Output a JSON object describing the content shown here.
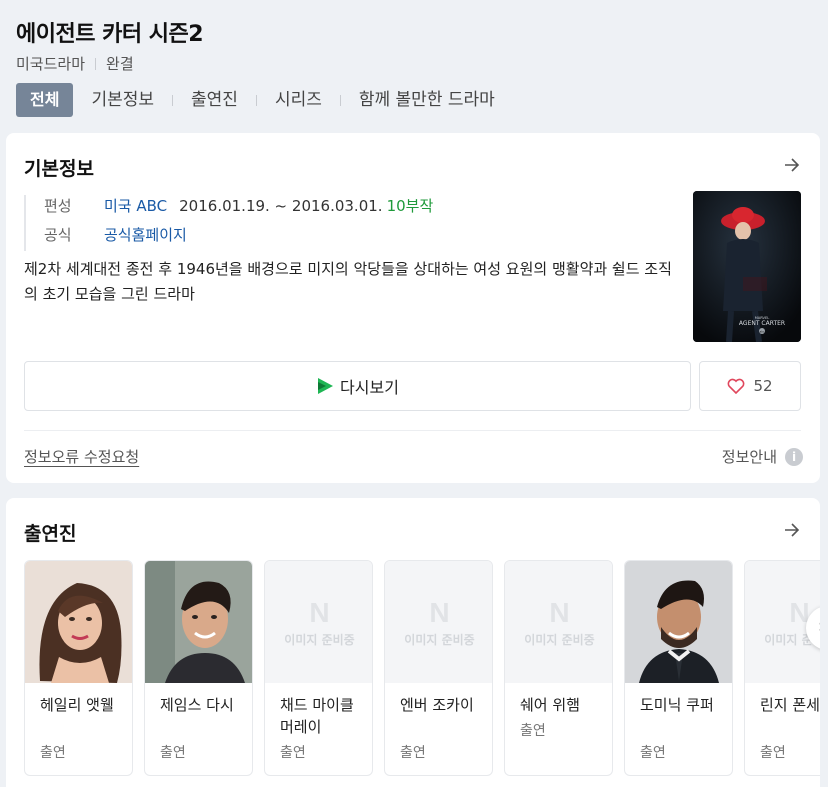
{
  "header": {
    "title": "에이전트 카터 시즌2",
    "meta": [
      "미국드라마",
      "완결"
    ],
    "tabs": [
      "전체",
      "기본정보",
      "출연진",
      "시리즈",
      "함께 볼만한 드라마"
    ]
  },
  "basic_info": {
    "title": "기본정보",
    "broadcast_label": "편성",
    "network": "미국 ABC",
    "dates": "2016.01.19. ~ 2016.03.01.",
    "episodes": "10부작",
    "official_label": "공식",
    "official_link": "공식홈페이지",
    "description": "제2차 세계대전 종전 후 1946년을 배경으로 미지의 악당들을 상대하는 여성 요원의 맹활약과 쉴드 조직의 초기 모습을 그린 드라마",
    "poster_text": "AGENT CARTER",
    "poster_brand": "MARVEL",
    "poster_network": "abc",
    "watch_label": "다시보기",
    "like_count": "52",
    "report_label": "정보오류 수정요청",
    "guide_label": "정보안내",
    "guide_icon": "i"
  },
  "cast": {
    "title": "출연진",
    "placeholder_logo": "N",
    "placeholder_text": "이미지 준비중",
    "members": [
      {
        "name": "헤일리 앳웰",
        "role": "출연"
      },
      {
        "name": "제임스 다시",
        "role": "출연"
      },
      {
        "name": "채드 마이클 머레이",
        "role": "출연"
      },
      {
        "name": "엔버 조카이",
        "role": "출연"
      },
      {
        "name": "쉐어 위햄",
        "role": "출연"
      },
      {
        "name": "도미닉 쿠퍼",
        "role": "출연"
      },
      {
        "name": "린지 폰세카",
        "role": "출연"
      }
    ],
    "next_icon": "›"
  },
  "colors": {
    "active_tab": "#768598",
    "link": "#1a5aa6",
    "episodes": "#1f9a3b",
    "like_heart": "#e0465c"
  }
}
